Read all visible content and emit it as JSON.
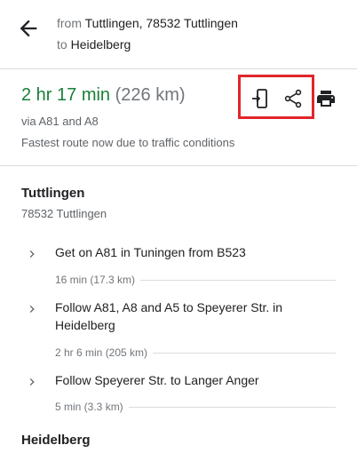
{
  "header": {
    "from_prefix": "from",
    "from_place": "Tuttlingen, 78532 Tuttlingen",
    "to_prefix": "to",
    "to_place": "Heidelberg"
  },
  "summary": {
    "duration": "2 hr 17 min",
    "distance": "(226 km)",
    "via": "via A81 and A8",
    "note": "Fastest route now due to traffic conditions"
  },
  "actions": {
    "send_icon": "send-to-phone-icon",
    "share_icon": "share-icon",
    "print_icon": "print-icon",
    "highlight_color": "#e0262b"
  },
  "origin": {
    "name": "Tuttlingen",
    "address": "78532 Tuttlingen"
  },
  "steps": [
    {
      "text": "Get on A81 in Tuningen from B523",
      "meta": "16 min (17.3 km)"
    },
    {
      "text": "Follow A81, A8 and A5 to Speyerer Str. in Heidelberg",
      "meta": "2 hr 6 min (205 km)"
    },
    {
      "text": "Follow Speyerer Str. to Langer Anger",
      "meta": "5 min (3.3 km)"
    }
  ],
  "destination": {
    "name": "Heidelberg"
  },
  "colors": {
    "duration_green": "#188038",
    "divider": "#dadce0"
  }
}
